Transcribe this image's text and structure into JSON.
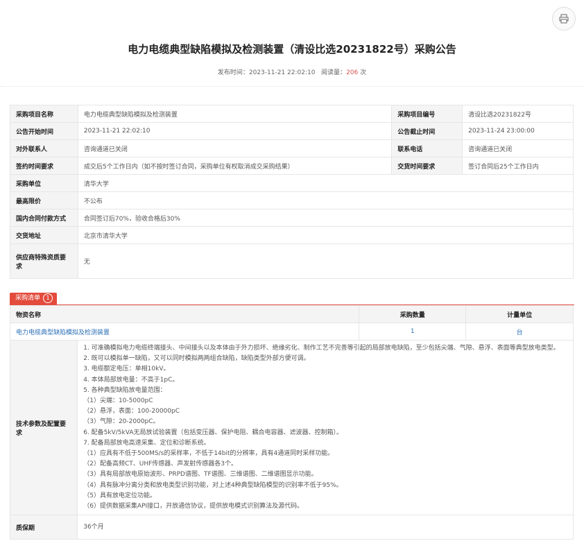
{
  "header": {
    "title": "电力电缆典型缺陷模拟及检测装置（清设比选20231822号）采购公告",
    "publish_label": "发布时间：",
    "publish_time": "2023-11-21 22:02:10",
    "views_label": "阅读量：",
    "views": "206",
    "views_unit": "次",
    "print_icon": "printer-icon"
  },
  "info": {
    "project_name_label": "采购项目名称",
    "project_name": "电力电缆典型缺陷模拟及检测装置",
    "project_no_label": "采购项目编号",
    "project_no": "清设比选20231822号",
    "start_time_label": "公告开始时间",
    "start_time": "2023-11-21 22:02:10",
    "end_time_label": "公告截止时间",
    "end_time": "2023-11-24 23:00:00",
    "contact_label": "对外联系人",
    "contact": "咨询通道已关闭",
    "phone_label": "联系电话",
    "phone": "咨询通道已关闭",
    "sign_time_label": "签约时间要求",
    "sign_time": "成交后5个工作日内（如不按时签订合同，采购单位有权取消成交采购结果）",
    "delivery_label": "交货时间要求",
    "delivery": "签订合同后25个工作日内",
    "unit_label": "采购单位",
    "unit": "清华大学",
    "max_price_label": "最高限价",
    "max_price": "不公布",
    "payment_label": "国内合同付款方式",
    "payment": "合同签订后70%，验收合格后30%",
    "address_label": "交货地址",
    "address": "北京市清华大学",
    "qualification_label": "供应商特殊资质要求",
    "qualification": "无"
  },
  "list": {
    "tab_label": "采购清单",
    "tab_count": "1",
    "col_name": "物资名称",
    "col_qty": "采购数量",
    "col_unit": "计量单位",
    "item_name": "电力电缆典型缺陷模拟及检测装置",
    "item_qty": "1",
    "item_unit": "台",
    "specs_label": "技术参数及配置要求",
    "specs": [
      "1. 可准确模拟电力电缆终端接头、中间接头以及本体由于外力损坏、绝缘劣化、制作工艺不完善等引起的局部放电缺陷，至少包括尖端、气隙、悬浮、表面等典型放电类型。",
      "2. 既可以模拟单一缺陷，又可以同时模拟两两组合缺陷，缺陷类型外部方便可调。",
      "3. 电缆额定电压：单相10kV。",
      "4. 本体局部放电量：不高于1pC。",
      "5. 各种典型缺陷放电量范围：",
      "（1）尖端：10-5000pC",
      "（2）悬浮，表面：100-20000pC",
      "（3）气隙：20-2000pC。",
      "6. 配备5kV/5kVA无局放试验装置（包括变压器、保护电阻、耦合电容器、滤波器、控制箱）。",
      "7. 配备局部放电高速采集、定位和诊断系统。",
      "（1）应具有不低于500MS/s的采样率，不低于14bit的分辨率，具有4通道同时采样功能。",
      "（2）配备高频CT、UHF传感器、声发射传感器各3个。",
      "（3）具有局部放电原始波形、PRPD谱图、TF谱图、三维谱图、二维谱图显示功能。",
      "（4）具有脉冲分离分类和放电类型识别功能，对上述4种典型缺陷模型的识别率不低于95%。",
      "（5）具有放电定位功能。",
      "（6）提供数据采集API接口，开放通信协议，提供放电模式识别算法及源代码。"
    ],
    "warranty_label": "质保期",
    "warranty": "36个月"
  }
}
